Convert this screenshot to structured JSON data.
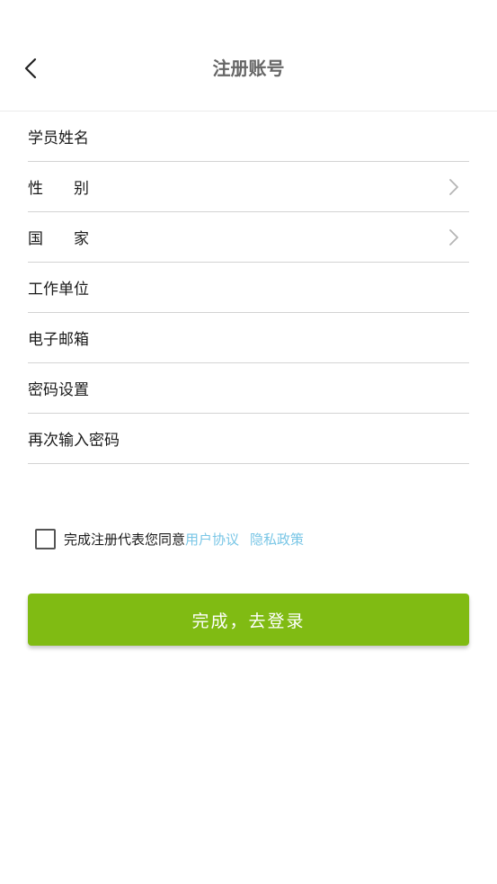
{
  "header": {
    "title": "注册账号",
    "back_icon": "chevron-left-icon"
  },
  "form": {
    "fields": [
      {
        "label": "学员姓名",
        "value": "",
        "type": "text"
      },
      {
        "label": "性　　别",
        "value": "",
        "type": "select"
      },
      {
        "label": "国　　家",
        "value": "",
        "type": "select"
      },
      {
        "label": "工作单位",
        "value": "",
        "type": "text"
      },
      {
        "label": "电子邮箱",
        "value": "",
        "type": "text"
      },
      {
        "label": "密码设置",
        "value": "",
        "type": "password"
      },
      {
        "label": "再次输入密码",
        "value": "",
        "type": "password"
      }
    ]
  },
  "agreement": {
    "checked": false,
    "text": "完成注册代表您同意",
    "user_agreement": "用户协议",
    "privacy_policy": "隐私政策"
  },
  "submit": {
    "label": "完成，去登录"
  },
  "colors": {
    "accent": "#80bb13",
    "link": "#79c6e6",
    "title": "#666666",
    "divider": "#d3d3d3"
  }
}
